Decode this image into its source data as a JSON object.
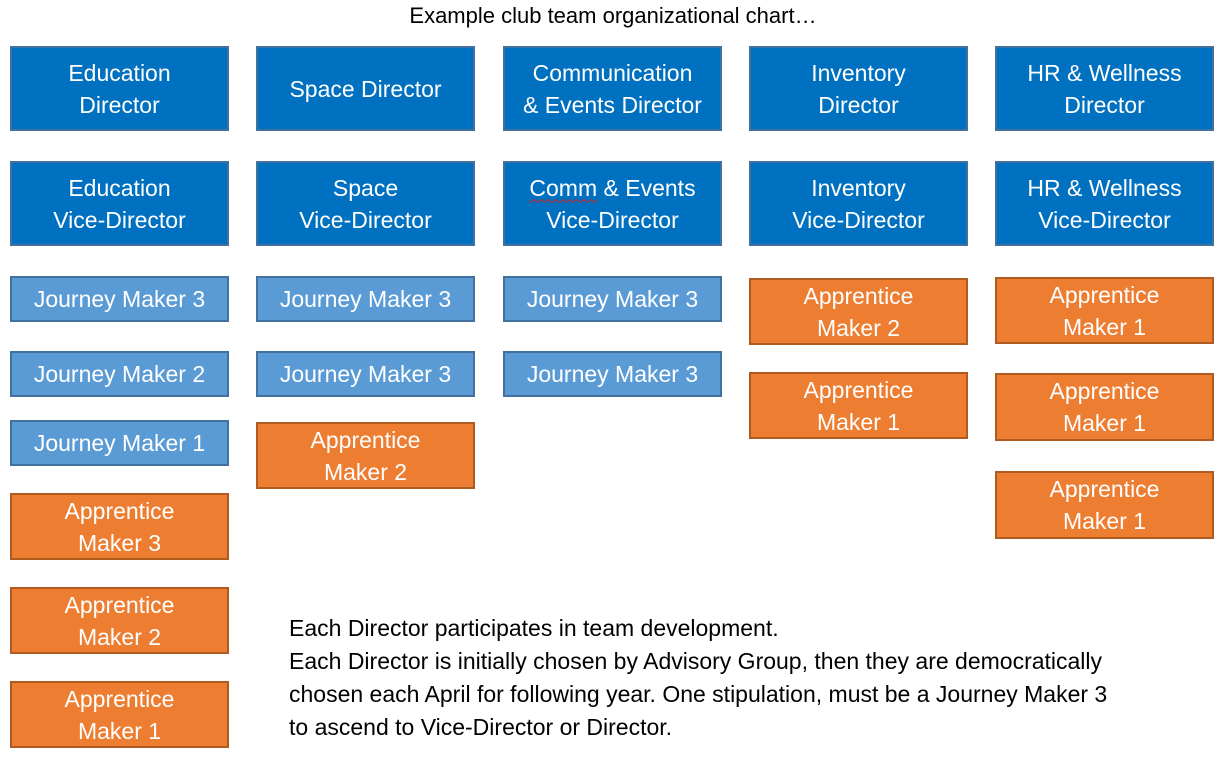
{
  "title": "Example club team organizational chart…",
  "columns": [
    {
      "director": [
        "Education",
        "Director"
      ],
      "vice": [
        "Education",
        "Vice-Director"
      ],
      "members": [
        {
          "type": "journey",
          "lines": [
            "Journey Maker 3"
          ]
        },
        {
          "type": "journey",
          "lines": [
            "Journey Maker 2"
          ]
        },
        {
          "type": "journey",
          "lines": [
            "Journey Maker 1"
          ]
        },
        {
          "type": "apprentice",
          "lines": [
            "Apprentice",
            "Maker 3"
          ]
        },
        {
          "type": "apprentice",
          "lines": [
            "Apprentice",
            "Maker 2"
          ]
        },
        {
          "type": "apprentice",
          "lines": [
            "Apprentice",
            "Maker 1"
          ]
        }
      ]
    },
    {
      "director": [
        "Space Director"
      ],
      "vice": [
        "Space",
        "Vice-Director"
      ],
      "members": [
        {
          "type": "journey",
          "lines": [
            "Journey Maker 3"
          ]
        },
        {
          "type": "journey",
          "lines": [
            "Journey Maker 3"
          ]
        },
        {
          "type": "apprentice",
          "lines": [
            "Apprentice",
            "Maker 2"
          ]
        }
      ]
    },
    {
      "director": [
        "Communication",
        "& Events Director"
      ],
      "vice": [
        "Comm & Events",
        "Vice-Director"
      ],
      "members": [
        {
          "type": "journey",
          "lines": [
            "Journey Maker 3"
          ]
        },
        {
          "type": "journey",
          "lines": [
            "Journey Maker 3"
          ]
        }
      ]
    },
    {
      "director": [
        "Inventory",
        "Director"
      ],
      "vice": [
        "Inventory",
        "Vice-Director"
      ],
      "members": [
        {
          "type": "apprentice",
          "lines": [
            "Apprentice",
            "Maker 2"
          ]
        },
        {
          "type": "apprentice",
          "lines": [
            "Apprentice",
            "Maker 1"
          ]
        }
      ]
    },
    {
      "director": [
        "HR & Wellness",
        "Director"
      ],
      "vice": [
        "HR & Wellness",
        "Vice-Director"
      ],
      "members": [
        {
          "type": "apprentice",
          "lines": [
            "Apprentice",
            "Maker 1"
          ]
        },
        {
          "type": "apprentice",
          "lines": [
            "Apprentice",
            "Maker 1"
          ]
        },
        {
          "type": "apprentice",
          "lines": [
            "Apprentice",
            "Maker 1"
          ]
        }
      ]
    }
  ],
  "note": [
    "Each Director participates in team development.",
    "Each Director is initially chosen by Advisory Group, then they are democratically",
    "chosen each April for following year. One stipulation, must be a Journey Maker 3",
    "to ascend to Vice-Director or Director."
  ],
  "colors": {
    "director": "#0070c0",
    "journey_maker": "#5b9bd5",
    "apprentice_maker": "#ed7d31"
  }
}
